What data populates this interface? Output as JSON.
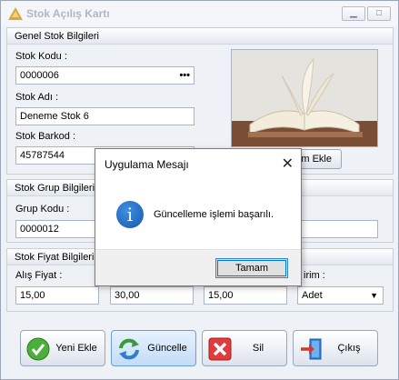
{
  "window": {
    "title": "Stok Açılış Kartı",
    "minimize_glyph": "▁",
    "maximize_glyph": "□",
    "close_glyph": "✕"
  },
  "general": {
    "header": "Genel Stok Bilgileri",
    "code_label": "Stok Kodu :",
    "code_value": "0000006",
    "code_button": "•••",
    "name_label": "Stok Adı :",
    "name_value": "Deneme Stok 6",
    "barcode_label": "Stok Barkod :",
    "barcode_value": "45787544",
    "add_image_button": "Resim Ekle",
    "add_image_visible": "m Ekle"
  },
  "group": {
    "header": "Stok Grup Bilgileri",
    "code_label": "Grup Kodu :",
    "code_value": "0000012"
  },
  "price": {
    "header": "Stok Fiyat Bilgileri",
    "buy_label": "Alış Fiyat :",
    "buy_value": "15,00",
    "price2_value": "30,00",
    "price3_value": "15,00",
    "unit_label": "irim :",
    "unit_value": "Adet"
  },
  "buttons": {
    "new": "Yeni Ekle",
    "update": "Güncelle",
    "delete": "Sil",
    "exit": "Çıkış"
  },
  "dialog": {
    "title": "Uygulama Mesajı",
    "message": "Güncelleme işlemi başarılı.",
    "ok": "Tamam",
    "close_glyph": "✕",
    "info_glyph": "i"
  },
  "colors": {
    "accent": "#0078d7",
    "info_icon": "#1c64c0",
    "window_bg": "#eef1f6"
  }
}
